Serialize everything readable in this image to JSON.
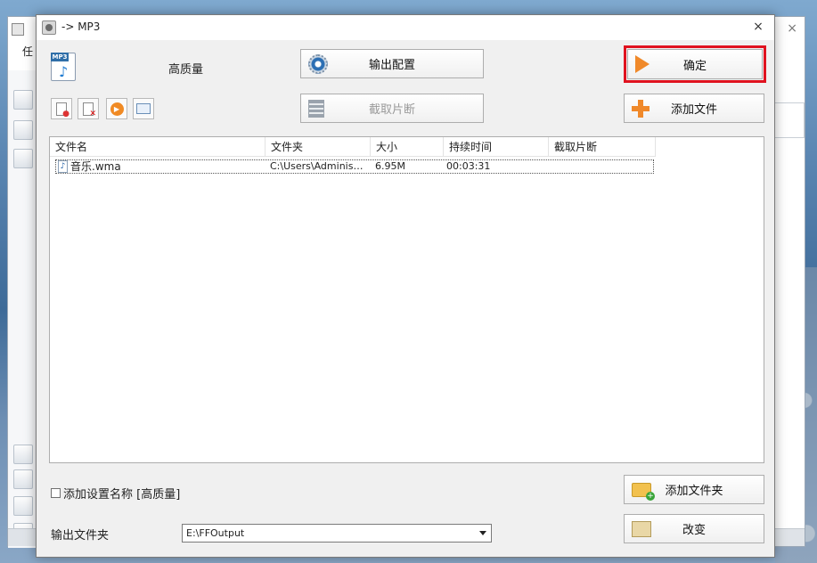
{
  "dialog": {
    "title": "-> MP3",
    "close_glyph": "×",
    "quality_label": "高质量"
  },
  "background_app": {
    "title_text": "",
    "menu_text": "任",
    "close_glyph": "×"
  },
  "buttons": {
    "output_config": "输出配置",
    "clip": "截取片断",
    "ok": "确定",
    "add_file": "添加文件",
    "add_folder": "添加文件夹",
    "change": "改变"
  },
  "highlight_color": "#e0121f",
  "file_list": {
    "columns": [
      "文件名",
      "文件夹",
      "大小",
      "持续时间",
      "截取片断"
    ],
    "rows": [
      {
        "name": "音乐.wma",
        "folder": "C:\\Users\\Administr...",
        "size": "6.95M",
        "duration": "00:03:31",
        "clip": ""
      }
    ]
  },
  "options": {
    "add_settings_name": "添加设置名称 [高质量]",
    "add_settings_checked": false
  },
  "output": {
    "label": "输出文件夹",
    "folder": "E:\\FFOutput"
  },
  "icons": {
    "mp3": "mp3-file-icon",
    "output_config": "gear-icon",
    "clip": "film-icon",
    "ok": "arrow-right-icon",
    "add_file": "plus-icon",
    "add_folder": "folder-add-icon",
    "change": "folder-icon"
  }
}
